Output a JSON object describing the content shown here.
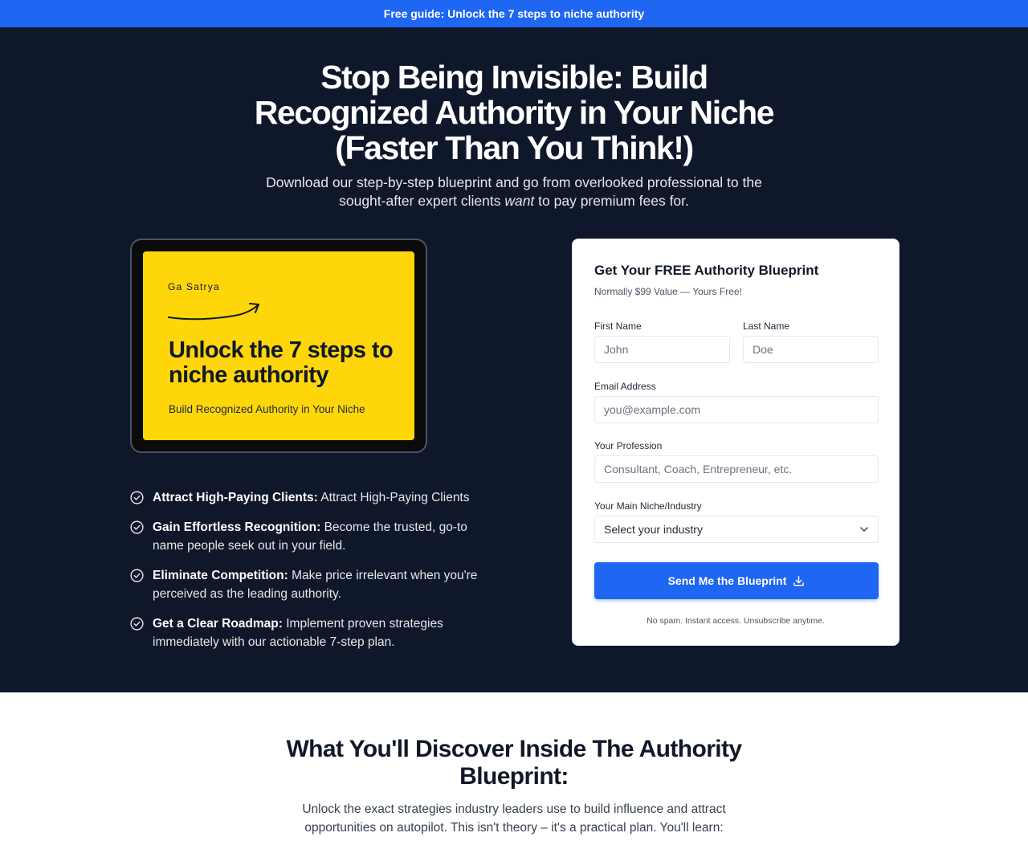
{
  "banner": {
    "text": "Free guide: Unlock the 7 steps to niche authority"
  },
  "hero": {
    "title": "Stop Being Invisible: Build Recognized Authority in Your Niche (Faster Than You Think!)",
    "subtitle_before": "Download our step-by-step blueprint and go from overlooked professional to the sought-after expert clients ",
    "subtitle_emphasis": "want",
    "subtitle_after": " to pay premium fees for."
  },
  "ebook_cover": {
    "author": "Ga Satrya",
    "title": "Unlock the 7 steps to niche authority",
    "subtitle": "Build Recognized Authority in Your Niche",
    "color": "#ffd60a"
  },
  "benefits": [
    {
      "title": "Attract High-Paying Clients:",
      "text": " Attract High-Paying Clients",
      "icon": "check-circle-icon"
    },
    {
      "title": "Gain Effortless Recognition:",
      "text": " Become the trusted, go-to name people seek out in your field.",
      "icon": "check-circle-icon"
    },
    {
      "title": "Eliminate Competition:",
      "text": " Make price irrelevant when you're perceived as the leading authority.",
      "icon": "check-circle-icon"
    },
    {
      "title": "Get a Clear Roadmap:",
      "text": " Implement proven strategies immediately with our actionable 7-step plan.",
      "icon": "check-circle-icon"
    }
  ],
  "form": {
    "title": "Get Your FREE Authority Blueprint",
    "note": "Normally $99 Value — Yours Free!",
    "first_name": {
      "label": "First Name",
      "placeholder": "John"
    },
    "last_name": {
      "label": "Last Name",
      "placeholder": "Doe"
    },
    "email": {
      "label": "Email Address",
      "placeholder": "you@example.com"
    },
    "profession": {
      "label": "Your Profession",
      "placeholder": "Consultant, Coach, Entrepreneur, etc."
    },
    "industry": {
      "label": "Your Main Niche/Industry",
      "selected": "Select your industry"
    },
    "submit_label": "Send Me the Blueprint",
    "footer": "No spam. Instant access. Unsubscribe anytime."
  },
  "discover": {
    "title": "What You'll Discover Inside The Authority Blueprint:",
    "subtitle": "Unlock the exact strategies industry leaders use to build influence and attract opportunities on autopilot. This isn't theory – it's a practical plan. You'll learn:"
  },
  "colors": {
    "accent": "#1f66f2",
    "hero_bg": "#0f172a"
  }
}
